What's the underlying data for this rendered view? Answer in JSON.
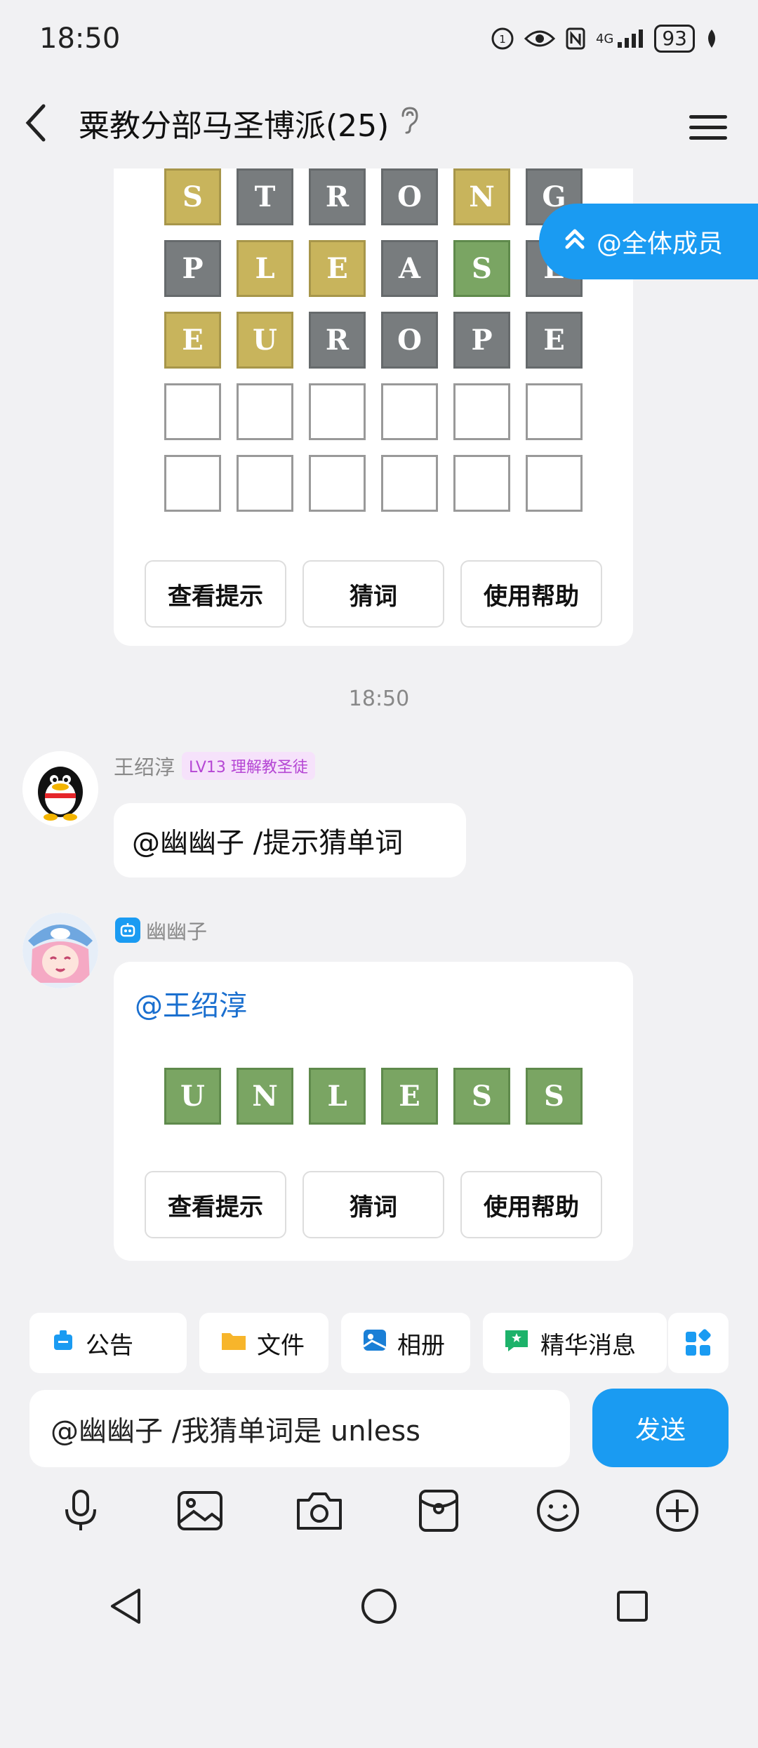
{
  "status": {
    "time": "18:50",
    "battery": "93",
    "network": "4G"
  },
  "header": {
    "title": "粟教分部马圣博派(25)"
  },
  "mention_all": {
    "label": "@全体成员"
  },
  "card1": {
    "rows": [
      [
        {
          "l": "S",
          "c": "y"
        },
        {
          "l": "T",
          "c": "g"
        },
        {
          "l": "R",
          "c": "g"
        },
        {
          "l": "O",
          "c": "g"
        },
        {
          "l": "N",
          "c": "y"
        },
        {
          "l": "G",
          "c": "g"
        }
      ],
      [
        {
          "l": "P",
          "c": "g"
        },
        {
          "l": "L",
          "c": "y"
        },
        {
          "l": "E",
          "c": "y"
        },
        {
          "l": "A",
          "c": "g"
        },
        {
          "l": "S",
          "c": "gr"
        },
        {
          "l": "E",
          "c": "g"
        }
      ],
      [
        {
          "l": "E",
          "c": "y"
        },
        {
          "l": "U",
          "c": "y"
        },
        {
          "l": "R",
          "c": "g"
        },
        {
          "l": "O",
          "c": "g"
        },
        {
          "l": "P",
          "c": "g"
        },
        {
          "l": "E",
          "c": "g"
        }
      ],
      [
        {
          "l": "",
          "c": "e"
        },
        {
          "l": "",
          "c": "e"
        },
        {
          "l": "",
          "c": "e"
        },
        {
          "l": "",
          "c": "e"
        },
        {
          "l": "",
          "c": "e"
        },
        {
          "l": "",
          "c": "e"
        }
      ],
      [
        {
          "l": "",
          "c": "e"
        },
        {
          "l": "",
          "c": "e"
        },
        {
          "l": "",
          "c": "e"
        },
        {
          "l": "",
          "c": "e"
        },
        {
          "l": "",
          "c": "e"
        },
        {
          "l": "",
          "c": "e"
        }
      ]
    ],
    "buttons": [
      "查看提示",
      "猜词",
      "使用帮助"
    ]
  },
  "timestamp": "18:50",
  "msg1": {
    "sender": "王绍淳",
    "level": "LV13 理解教圣徒",
    "text": "@幽幽子 /提示猜单词"
  },
  "msg2": {
    "sender": "幽幽子",
    "mention": "@王绍淳",
    "word": [
      {
        "l": "U",
        "c": "gr"
      },
      {
        "l": "N",
        "c": "gr"
      },
      {
        "l": "L",
        "c": "gr"
      },
      {
        "l": "E",
        "c": "gr"
      },
      {
        "l": "S",
        "c": "gr"
      },
      {
        "l": "S",
        "c": "gr"
      }
    ],
    "buttons": [
      "查看提示",
      "猜词",
      "使用帮助"
    ]
  },
  "quick": {
    "notice": "公告",
    "file": "文件",
    "album": "相册",
    "essence": "精华消息"
  },
  "input": {
    "value": "@幽幽子 /我猜单词是 unless"
  },
  "send_label": "发送",
  "colors": {
    "accent": "#1a9bf2",
    "yellow": "#c8b45c",
    "gray": "#787c7e",
    "green": "#7aa563"
  }
}
